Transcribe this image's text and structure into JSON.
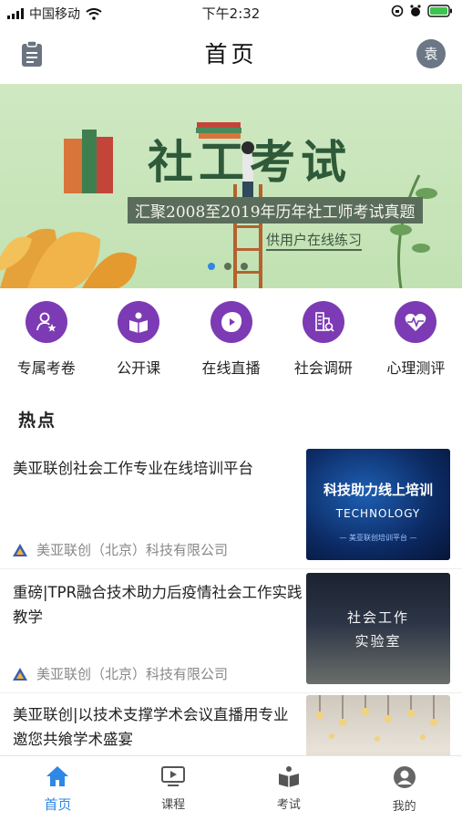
{
  "status_bar": {
    "carrier": "中国移动",
    "time": "下午2:32"
  },
  "navbar": {
    "title": "首页",
    "avatar_text": "袁"
  },
  "banner": {
    "title": "社工考试",
    "subtitle": "汇聚2008至2019年历年社工师考试真题",
    "caption": "供用户在线练习",
    "slides": 3,
    "active_slide": 1
  },
  "quick_menu": [
    {
      "label": "专属考卷",
      "icon": "person-star-icon"
    },
    {
      "label": "公开课",
      "icon": "reading-book-icon"
    },
    {
      "label": "在线直播",
      "icon": "play-icon"
    },
    {
      "label": "社会调研",
      "icon": "buildings-search-icon"
    },
    {
      "label": "心理测评",
      "icon": "heart-pulse-icon"
    }
  ],
  "hot": {
    "title": "热点",
    "items": [
      {
        "headline": "美亚联创社会工作专业在线培训平台",
        "source": "美亚联创（北京）科技有限公司",
        "thumb_line1": "科技助力线上培训",
        "thumb_line2": "TECHNOLOGY",
        "thumb_line3": "— 美亚联创培训平台 —"
      },
      {
        "headline": "重磅|TPR融合技术助力后疫情社会工作实践教学",
        "source": "美亚联创（北京）科技有限公司",
        "thumb_line1": "社会工作",
        "thumb_line2": "实验室"
      },
      {
        "headline": "美亚联创|以技术支撑学术会议直播用专业邀您共飨学术盛宴"
      }
    ]
  },
  "tabbar": [
    {
      "label": "首页",
      "icon": "home-icon",
      "active": true
    },
    {
      "label": "课程",
      "icon": "video-play-icon",
      "active": false
    },
    {
      "label": "考试",
      "icon": "open-book-icon",
      "active": false
    },
    {
      "label": "我的",
      "icon": "user-icon",
      "active": false
    }
  ],
  "colors": {
    "accent": "#2f87e6",
    "menu_icon_bg": "#7c3bb4",
    "banner_bg": "#c8e5ba"
  }
}
